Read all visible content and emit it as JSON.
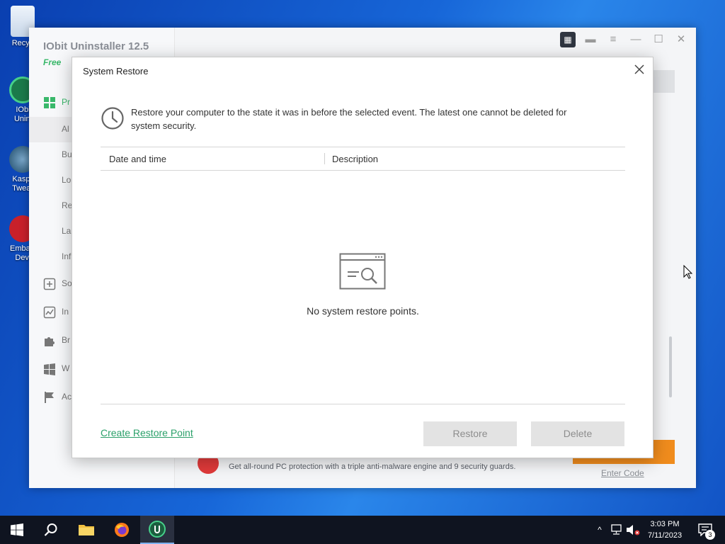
{
  "desktop": {
    "icons": [
      {
        "label": "Recyc"
      },
      {
        "label": "IObit Unins"
      },
      {
        "label": "Kaspe Tweak"
      },
      {
        "label": "Embarc Dev-"
      }
    ]
  },
  "app": {
    "title": "IObit Uninstaller 12.5",
    "edition": "Free",
    "sidebar": {
      "items": [
        {
          "label": "Pr",
          "icon": "grid-icon"
        },
        {
          "label": "Al",
          "icon": ""
        },
        {
          "label": "Bu",
          "icon": ""
        },
        {
          "label": "Lo",
          "icon": ""
        },
        {
          "label": "Re",
          "icon": ""
        },
        {
          "label": "La",
          "icon": ""
        },
        {
          "label": "Inf",
          "icon": ""
        },
        {
          "label": "So",
          "icon": "plus-box-icon"
        },
        {
          "label": "In",
          "icon": "chart-icon"
        },
        {
          "label": "Br",
          "icon": "puzzle-icon"
        },
        {
          "label": "W",
          "icon": "windows-icon"
        },
        {
          "label": "Ac",
          "icon": "flag-icon"
        }
      ]
    },
    "promo_text": "Get all-round PC protection with a triple anti-malware engine and 9 security guards.",
    "enter_code": "Enter Code"
  },
  "dialog": {
    "title": "System Restore",
    "info_line1": "Restore your computer to the state it was in before the selected event. The latest one cannot be deleted for",
    "info_line2": "system security.",
    "columns": [
      "Date and time",
      "Description"
    ],
    "empty_message": "No system restore points.",
    "create_link": "Create Restore Point",
    "restore_label": "Restore",
    "delete_label": "Delete",
    "accent_color": "#2ba06a"
  },
  "taskbar": {
    "time": "3:03 PM",
    "date": "7/11/2023",
    "notification_count": "3"
  }
}
